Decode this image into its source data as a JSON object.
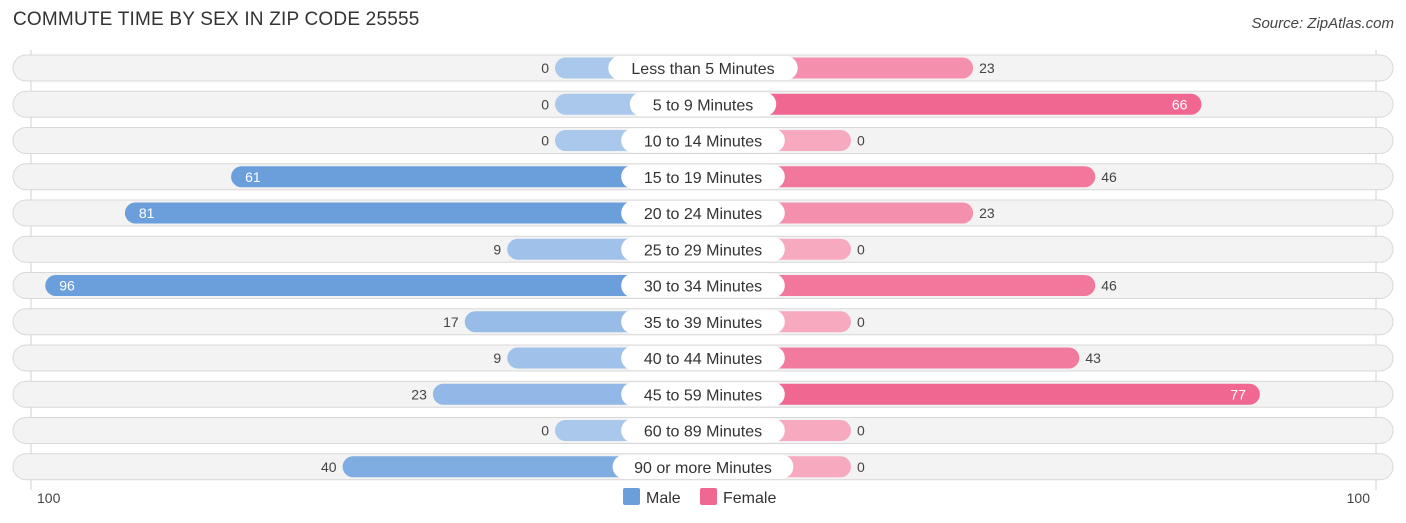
{
  "chart_data": {
    "type": "bar",
    "orientation": "horizontal-diverging",
    "title": "COMMUTE TIME BY SEX IN ZIP CODE 25555",
    "source": "Source: ZipAtlas.com",
    "categories": [
      "Less than 5 Minutes",
      "5 to 9 Minutes",
      "10 to 14 Minutes",
      "15 to 19 Minutes",
      "20 to 24 Minutes",
      "25 to 29 Minutes",
      "30 to 34 Minutes",
      "35 to 39 Minutes",
      "40 to 44 Minutes",
      "45 to 59 Minutes",
      "60 to 89 Minutes",
      "90 or more Minutes"
    ],
    "series": [
      {
        "name": "Male",
        "color": "#6a9fdc",
        "light_color": "#a9c8ec",
        "values": [
          0,
          0,
          0,
          61,
          81,
          9,
          96,
          17,
          9,
          23,
          0,
          40
        ]
      },
      {
        "name": "Female",
        "color": "#f06892",
        "light_color": "#f7a9c0",
        "values": [
          23,
          66,
          0,
          46,
          23,
          0,
          46,
          0,
          43,
          77,
          0,
          0
        ]
      }
    ],
    "axis": {
      "left_label": "100",
      "right_label": "100",
      "max": 100
    },
    "legend": {
      "position": "bottom-center",
      "items": [
        "Male",
        "Female"
      ]
    }
  }
}
